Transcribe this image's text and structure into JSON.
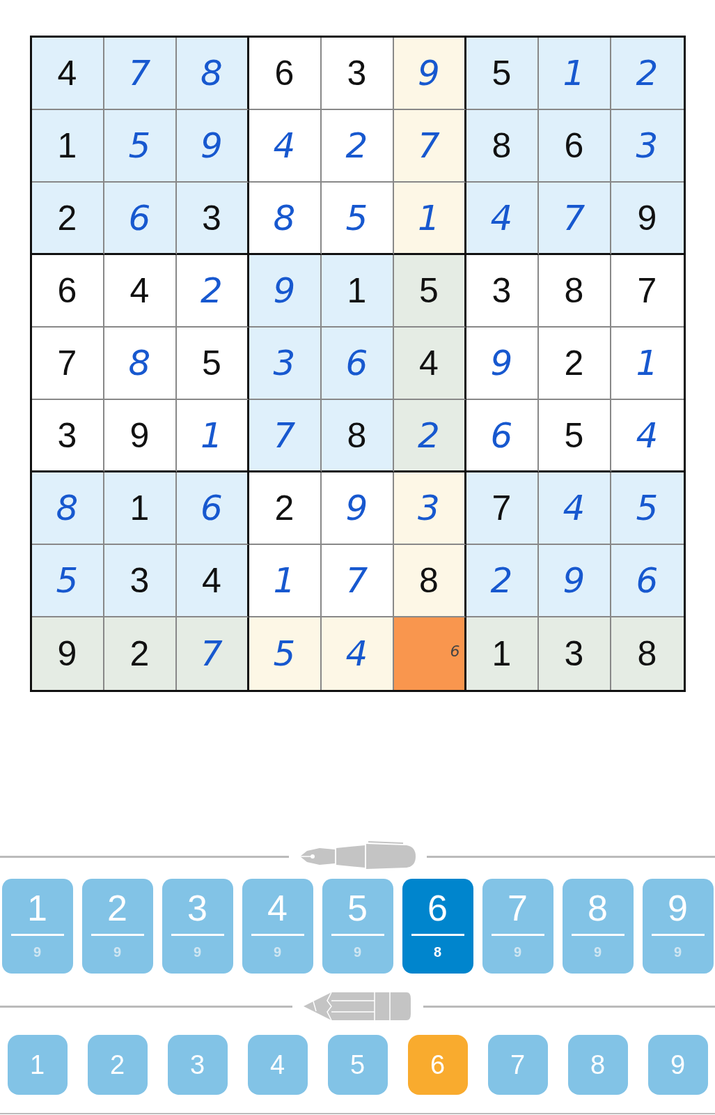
{
  "board": {
    "rows": [
      {
        "cells": [
          {
            "value": "4",
            "kind": "given",
            "selected": false
          },
          {
            "value": "7",
            "kind": "entered",
            "selected": false
          },
          {
            "value": "8",
            "kind": "entered",
            "selected": false
          },
          {
            "value": "6",
            "kind": "given",
            "selected": false
          },
          {
            "value": "3",
            "kind": "given",
            "selected": false
          },
          {
            "value": "9",
            "kind": "entered",
            "selected": false
          },
          {
            "value": "5",
            "kind": "given",
            "selected": false
          },
          {
            "value": "1",
            "kind": "entered",
            "selected": false
          },
          {
            "value": "2",
            "kind": "entered",
            "selected": false
          }
        ]
      },
      {
        "cells": [
          {
            "value": "1",
            "kind": "given",
            "selected": false
          },
          {
            "value": "5",
            "kind": "entered",
            "selected": false
          },
          {
            "value": "9",
            "kind": "entered",
            "selected": false
          },
          {
            "value": "4",
            "kind": "entered",
            "selected": false
          },
          {
            "value": "2",
            "kind": "entered",
            "selected": false
          },
          {
            "value": "7",
            "kind": "entered",
            "selected": false
          },
          {
            "value": "8",
            "kind": "given",
            "selected": false
          },
          {
            "value": "6",
            "kind": "given",
            "selected": false
          },
          {
            "value": "3",
            "kind": "entered",
            "selected": false
          }
        ]
      },
      {
        "cells": [
          {
            "value": "2",
            "kind": "given",
            "selected": false
          },
          {
            "value": "6",
            "kind": "entered",
            "selected": false
          },
          {
            "value": "3",
            "kind": "given",
            "selected": false
          },
          {
            "value": "8",
            "kind": "entered",
            "selected": false
          },
          {
            "value": "5",
            "kind": "entered",
            "selected": false
          },
          {
            "value": "1",
            "kind": "entered",
            "selected": false
          },
          {
            "value": "4",
            "kind": "entered",
            "selected": false
          },
          {
            "value": "7",
            "kind": "entered",
            "selected": false
          },
          {
            "value": "9",
            "kind": "given",
            "selected": false
          }
        ]
      },
      {
        "cells": [
          {
            "value": "6",
            "kind": "given",
            "selected": false
          },
          {
            "value": "4",
            "kind": "given",
            "selected": false
          },
          {
            "value": "2",
            "kind": "entered",
            "selected": false
          },
          {
            "value": "9",
            "kind": "entered",
            "selected": false
          },
          {
            "value": "1",
            "kind": "given",
            "selected": false
          },
          {
            "value": "5",
            "kind": "given",
            "selected": false
          },
          {
            "value": "3",
            "kind": "given",
            "selected": false
          },
          {
            "value": "8",
            "kind": "given",
            "selected": false
          },
          {
            "value": "7",
            "kind": "given",
            "selected": false
          }
        ]
      },
      {
        "cells": [
          {
            "value": "7",
            "kind": "given",
            "selected": false
          },
          {
            "value": "8",
            "kind": "entered",
            "selected": false
          },
          {
            "value": "5",
            "kind": "given",
            "selected": false
          },
          {
            "value": "3",
            "kind": "entered",
            "selected": false
          },
          {
            "value": "6",
            "kind": "entered",
            "selected": false
          },
          {
            "value": "4",
            "kind": "given",
            "selected": false
          },
          {
            "value": "9",
            "kind": "entered",
            "selected": false
          },
          {
            "value": "2",
            "kind": "given",
            "selected": false
          },
          {
            "value": "1",
            "kind": "entered",
            "selected": false
          }
        ]
      },
      {
        "cells": [
          {
            "value": "3",
            "kind": "given",
            "selected": false
          },
          {
            "value": "9",
            "kind": "given",
            "selected": false
          },
          {
            "value": "1",
            "kind": "entered",
            "selected": false
          },
          {
            "value": "7",
            "kind": "entered",
            "selected": false
          },
          {
            "value": "8",
            "kind": "given",
            "selected": false
          },
          {
            "value": "2",
            "kind": "entered",
            "selected": false
          },
          {
            "value": "6",
            "kind": "entered",
            "selected": false
          },
          {
            "value": "5",
            "kind": "given",
            "selected": false
          },
          {
            "value": "4",
            "kind": "entered",
            "selected": false
          }
        ]
      },
      {
        "cells": [
          {
            "value": "8",
            "kind": "entered",
            "selected": false
          },
          {
            "value": "1",
            "kind": "given",
            "selected": false
          },
          {
            "value": "6",
            "kind": "entered",
            "selected": false
          },
          {
            "value": "2",
            "kind": "given",
            "selected": false
          },
          {
            "value": "9",
            "kind": "entered",
            "selected": false
          },
          {
            "value": "3",
            "kind": "entered",
            "selected": false
          },
          {
            "value": "7",
            "kind": "given",
            "selected": false
          },
          {
            "value": "4",
            "kind": "entered",
            "selected": false
          },
          {
            "value": "5",
            "kind": "entered",
            "selected": false
          }
        ]
      },
      {
        "cells": [
          {
            "value": "5",
            "kind": "entered",
            "selected": false
          },
          {
            "value": "3",
            "kind": "given",
            "selected": false
          },
          {
            "value": "4",
            "kind": "given",
            "selected": false
          },
          {
            "value": "1",
            "kind": "entered",
            "selected": false
          },
          {
            "value": "7",
            "kind": "entered",
            "selected": false
          },
          {
            "value": "8",
            "kind": "given",
            "selected": false
          },
          {
            "value": "2",
            "kind": "entered",
            "selected": false
          },
          {
            "value": "9",
            "kind": "entered",
            "selected": false
          },
          {
            "value": "6",
            "kind": "entered",
            "selected": false
          }
        ]
      },
      {
        "cells": [
          {
            "value": "9",
            "kind": "given",
            "selected": false
          },
          {
            "value": "2",
            "kind": "given",
            "selected": false
          },
          {
            "value": "7",
            "kind": "entered",
            "selected": false
          },
          {
            "value": "5",
            "kind": "entered",
            "selected": false
          },
          {
            "value": "4",
            "kind": "entered",
            "selected": false
          },
          {
            "kind": "empty",
            "note": "6",
            "selected": true
          },
          {
            "value": "1",
            "kind": "given",
            "selected": false
          },
          {
            "value": "3",
            "kind": "given",
            "selected": false
          },
          {
            "value": "8",
            "kind": "given",
            "selected": false
          }
        ]
      }
    ]
  },
  "pen_keys": [
    {
      "digit": "1",
      "count": "9",
      "selected": false
    },
    {
      "digit": "2",
      "count": "9",
      "selected": false
    },
    {
      "digit": "3",
      "count": "9",
      "selected": false
    },
    {
      "digit": "4",
      "count": "9",
      "selected": false
    },
    {
      "digit": "5",
      "count": "9",
      "selected": false
    },
    {
      "digit": "6",
      "count": "8",
      "selected": true
    },
    {
      "digit": "7",
      "count": "9",
      "selected": false
    },
    {
      "digit": "8",
      "count": "9",
      "selected": false
    },
    {
      "digit": "9",
      "count": "9",
      "selected": false
    }
  ],
  "pencil_keys": [
    {
      "digit": "1",
      "selected": false
    },
    {
      "digit": "2",
      "selected": false
    },
    {
      "digit": "3",
      "selected": false
    },
    {
      "digit": "4",
      "selected": false
    },
    {
      "digit": "5",
      "selected": false
    },
    {
      "digit": "6",
      "selected": true
    },
    {
      "digit": "7",
      "selected": false
    },
    {
      "digit": "8",
      "selected": false
    },
    {
      "digit": "9",
      "selected": false
    }
  ]
}
